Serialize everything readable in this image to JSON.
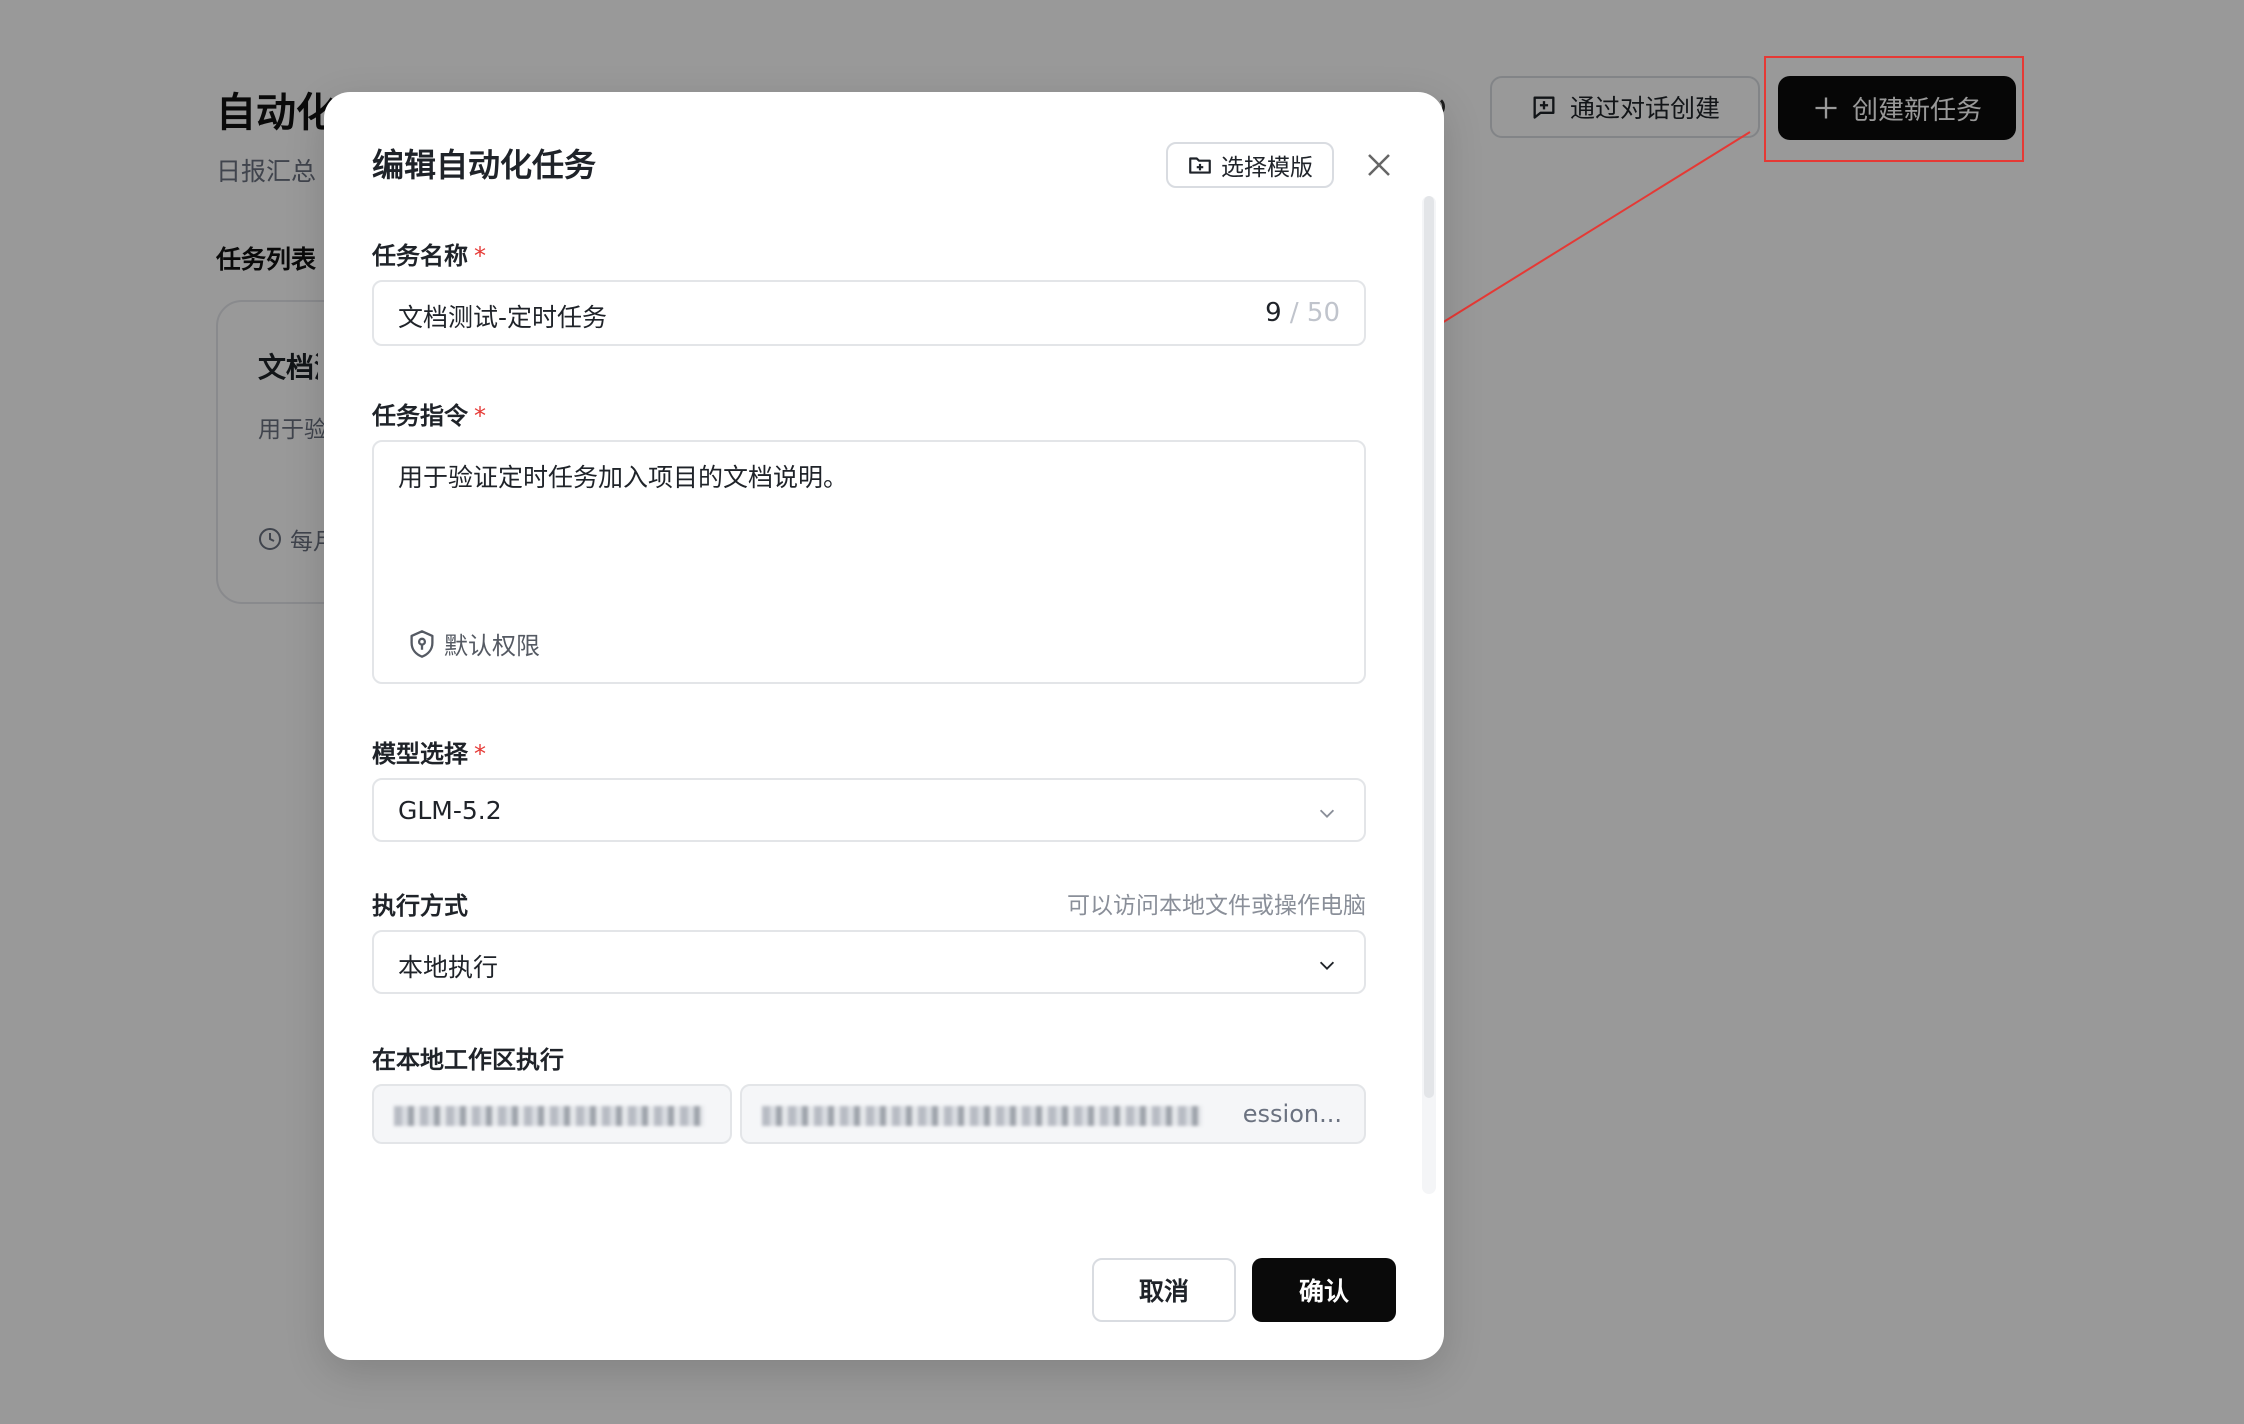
{
  "background": {
    "title": "自动化",
    "subtitle": "日报汇总",
    "section_title": "任务列表",
    "card": {
      "title": "文档测试-定时任务",
      "desc": "用于验证定时任务加入项目的文档说明。",
      "schedule": "每月"
    },
    "refresh_icon": "refresh-icon",
    "chat_create_label": "通过对话创建",
    "new_task_label": "创建新任务"
  },
  "modal": {
    "title": "编辑自动化任务",
    "template_label": "选择模版",
    "fields": {
      "name": {
        "label": "任务名称",
        "required_mark": "*",
        "value": "文档测试-定时任务",
        "count": "9",
        "max": "/ 50"
      },
      "instruction": {
        "label": "任务指令",
        "required_mark": "*",
        "value": "用于验证定时任务加入项目的文档说明。",
        "permission_label": "默认权限"
      },
      "model": {
        "label": "模型选择",
        "required_mark": "*",
        "value": "GLM-5.2"
      },
      "exec_mode": {
        "label": "执行方式",
        "hint": "可以访问本地文件或操作电脑",
        "value": "本地执行"
      },
      "workspace": {
        "label": "在本地工作区执行",
        "path_tail": "ession..."
      }
    },
    "cancel_label": "取消",
    "confirm_label": "确认"
  },
  "colors": {
    "annotation": "#e53935",
    "primary": "#0a0a0a",
    "required": "#e53935"
  }
}
